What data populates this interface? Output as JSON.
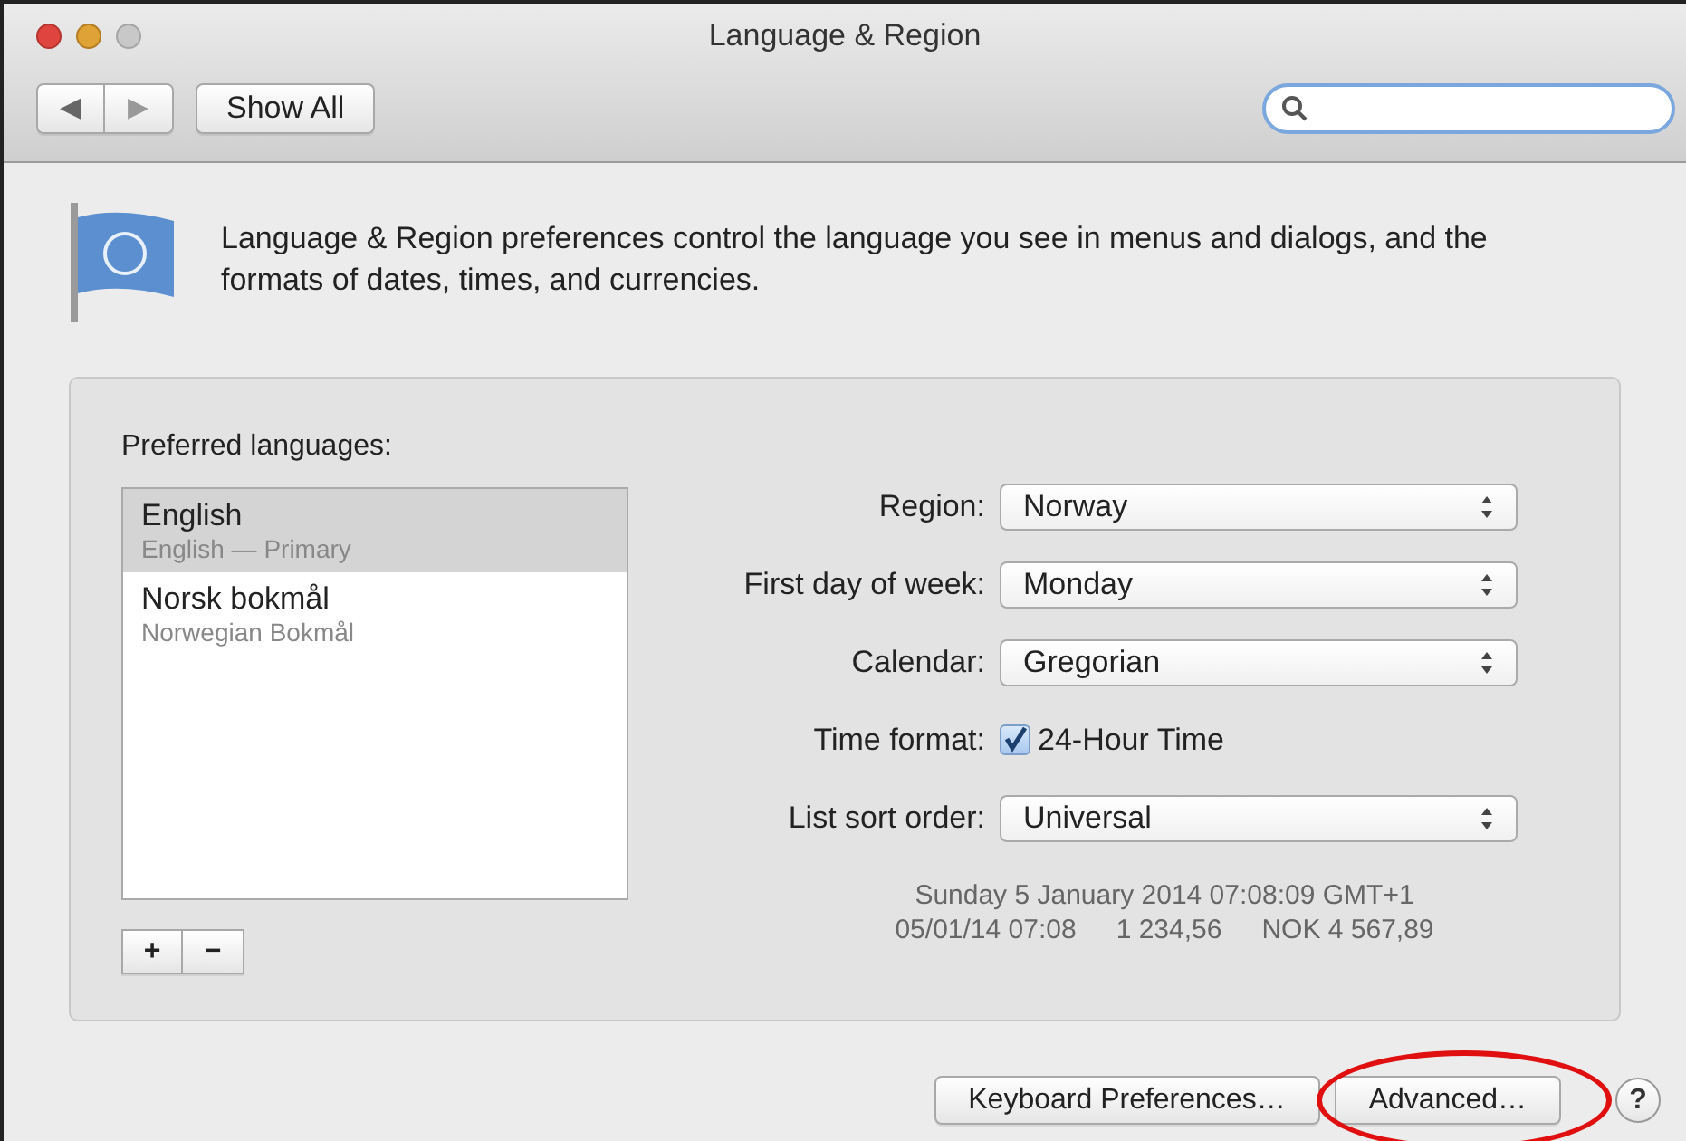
{
  "window": {
    "title": "Language & Region"
  },
  "toolbar": {
    "back": "◀",
    "forward": "▶",
    "show_all": "Show All"
  },
  "description": "Language & Region preferences control the language you see in menus and dialogs, and the formats of dates, times, and currencies.",
  "languages": {
    "label": "Preferred languages:",
    "items": [
      {
        "name": "English",
        "subtitle": "English — Primary",
        "selected": true
      },
      {
        "name": "Norsk bokmål",
        "subtitle": "Norwegian Bokmål",
        "selected": false
      }
    ],
    "add": "+",
    "remove": "−"
  },
  "settings": [
    {
      "kind": "popup",
      "label": "Region:",
      "value": "Norway"
    },
    {
      "kind": "popup",
      "label": "First day of week:",
      "value": "Monday"
    },
    {
      "kind": "popup",
      "label": "Calendar:",
      "value": "Gregorian"
    },
    {
      "kind": "checkbox",
      "label": "Time format:",
      "value": "24-Hour Time",
      "checked": true
    },
    {
      "kind": "popup",
      "label": "List sort order:",
      "value": "Universal"
    }
  ],
  "sample": {
    "line_1": "Sunday 5 January 2014 07:08:09 GMT+1",
    "line_2": [
      "05/01/14 07:08",
      "1 234,56",
      "NOK 4 567,89"
    ]
  },
  "buttons": [
    {
      "label": "Keyboard Preferences…",
      "highlighted": false
    },
    {
      "label": "Advanced…",
      "highlighted": true
    }
  ],
  "help": "?"
}
